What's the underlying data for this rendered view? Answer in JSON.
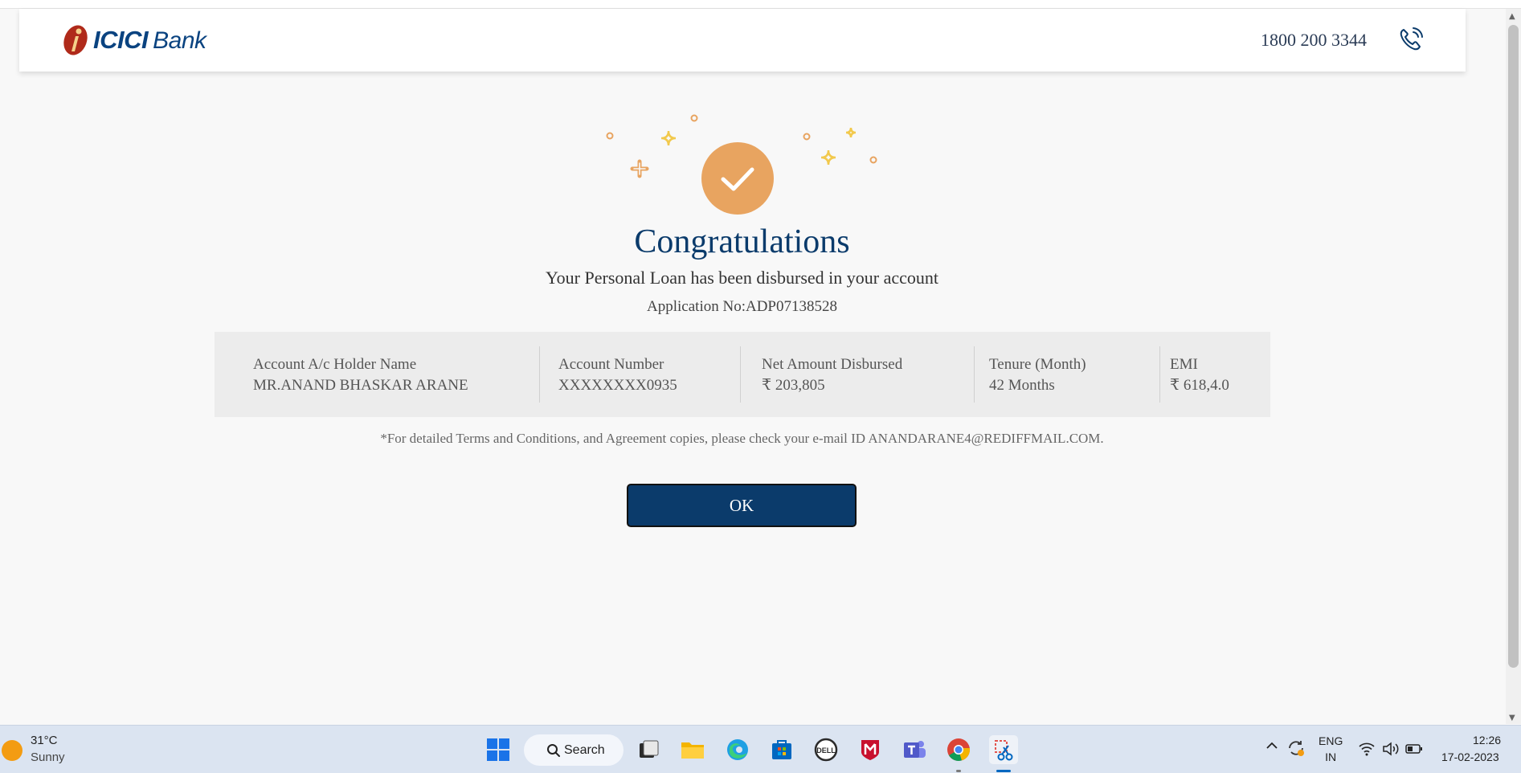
{
  "header": {
    "logo_brand": "ICICI",
    "logo_bank": "Bank",
    "phone": "1800 200 3344",
    "phone_icon": "phone-icon"
  },
  "success": {
    "title": "Congratulations",
    "subtitle": "Your Personal Loan has been disbursed in your account",
    "application_no": "Application No:ADP07138528",
    "accent_color": "#e8a460"
  },
  "details": [
    {
      "label": "Account A/c Holder Name",
      "value": "MR.ANAND BHASKAR ARANE"
    },
    {
      "label": "Account Number",
      "value": "XXXXXXXX0935"
    },
    {
      "label": "Net Amount Disbursed",
      "value": "₹ 203,805"
    },
    {
      "label": "Tenure (Month)",
      "value": "42 Months"
    },
    {
      "label": "EMI",
      "value": "₹ 618,4.0"
    }
  ],
  "terms": "*For detailed Terms and Conditions, and Agreement copies, please check your e-mail ID ANANDARANE4@REDIFFMAIL.COM.",
  "ok_label": "OK",
  "brand_color": "#0b3b6b",
  "taskbar": {
    "temp": "31°C",
    "weather": "Sunny",
    "search_label": "Search",
    "lang": "ENG",
    "region": "IN",
    "time": "12:26",
    "date": "17-02-2023"
  }
}
